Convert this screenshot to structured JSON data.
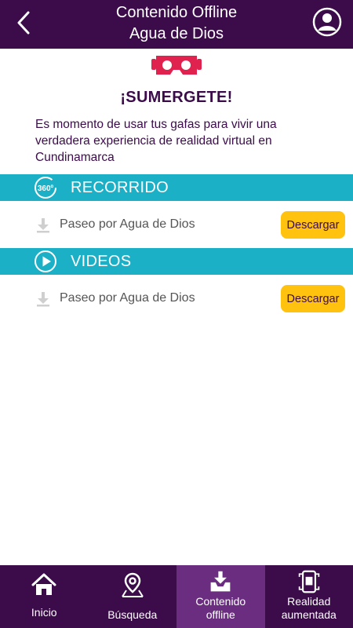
{
  "header": {
    "title_line1": "Contenido Offline",
    "title_line2": "Agua de Dios"
  },
  "intro": {
    "heading": "¡SUMERGETE!",
    "text": "Es momento de usar tus gafas para vivir una verdadera experiencia de realidad virtual en Cundinamarca"
  },
  "sections": [
    {
      "title": "RECORRIDO",
      "icon": "360-icon",
      "icon_text": "360º",
      "items": [
        {
          "label": "Paseo por Agua de Dios",
          "button": "Descargar"
        }
      ]
    },
    {
      "title": "VIDEOS",
      "icon": "play-icon",
      "items": [
        {
          "label": "Paseo por Agua de Dios",
          "button": "Descargar"
        }
      ]
    }
  ],
  "bottom_nav": [
    {
      "label": "Inicio",
      "icon": "home-icon"
    },
    {
      "label": "Búsqueda",
      "icon": "map-pin-icon"
    },
    {
      "label_line1": "Contenido",
      "label_line2": "offline",
      "icon": "download-tray-icon",
      "active": true
    },
    {
      "label_line1": "Realidad",
      "label_line2": "aumentada",
      "icon": "ar-phone-icon"
    }
  ],
  "colors": {
    "primary": "#3b0b4a",
    "section_bar": "#1cb0c7",
    "button": "#ffc20e",
    "vr_icon": "#e0224f",
    "nav_active": "#6a2d80"
  }
}
